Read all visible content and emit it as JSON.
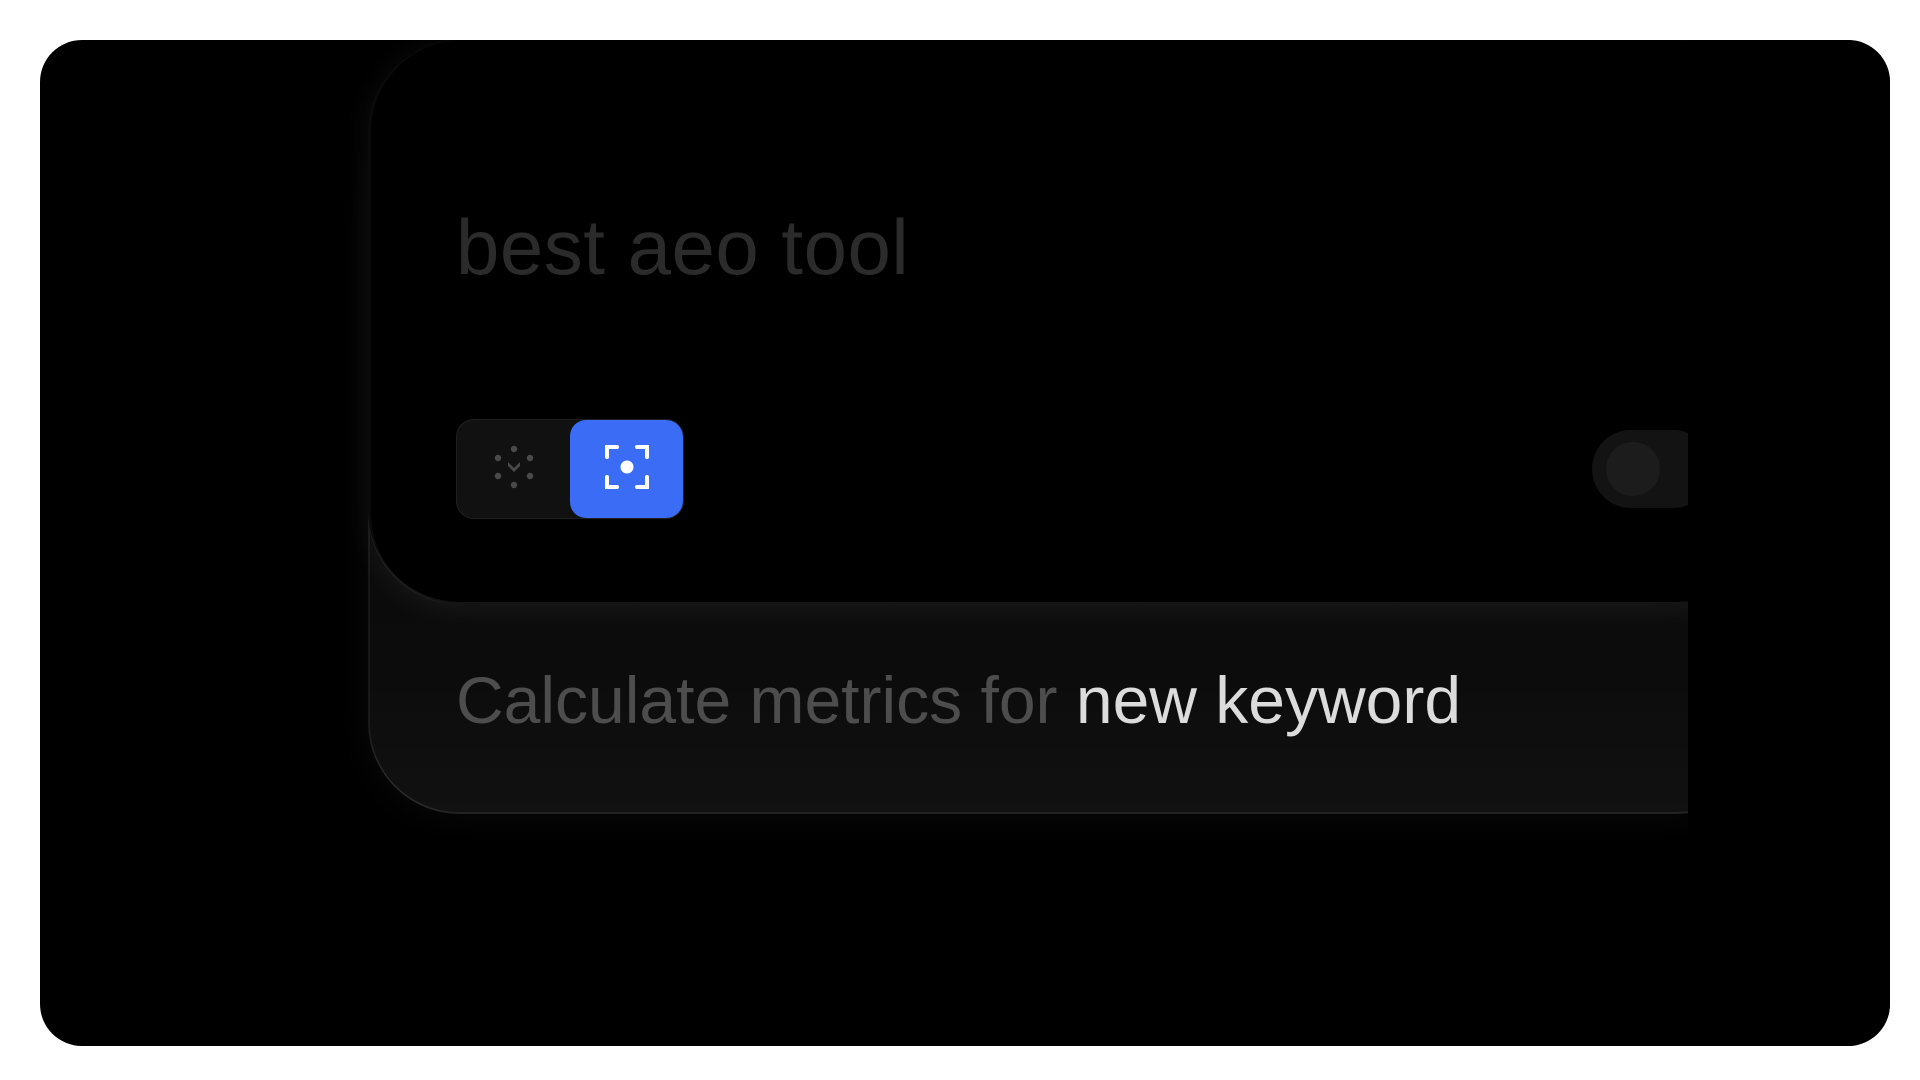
{
  "search": {
    "query": "best aeo tool"
  },
  "modes": [
    {
      "icon": "sparkle-scan-icon",
      "active": false
    },
    {
      "icon": "focus-target-icon",
      "active": true
    }
  ],
  "suggestion": {
    "prefix": "Calculate metrics for",
    "highlight": "new keyword"
  },
  "colors": {
    "accent": "#3a6cf6",
    "background": "#000000"
  }
}
